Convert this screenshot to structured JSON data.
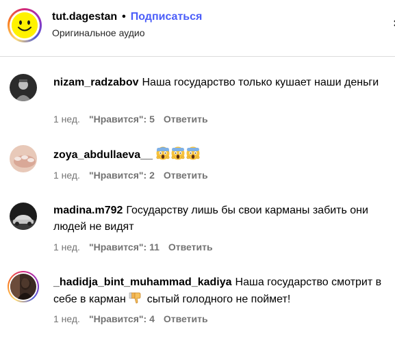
{
  "header": {
    "username": "tut.dagestan",
    "dot": "•",
    "follow_label": "Подписаться",
    "subtitle": "Оригинальное аудио",
    "avatar_icon": "smiley-face-icon",
    "follow_color": "#4a5df9"
  },
  "comments": [
    {
      "username": "nizam_radzabov",
      "text": "Наша государство только кушает наши деньги",
      "time": "1 нед.",
      "likes": "\"Нравится\": 5",
      "reply": "Ответить"
    },
    {
      "username": "zoya_abdullaeva__",
      "text": "",
      "emojis": [
        "scream-emoji",
        "scream-emoji",
        "scream-emoji"
      ],
      "time": "1 нед.",
      "likes": "\"Нравится\": 2",
      "reply": "Ответить"
    },
    {
      "username": "madina.m792",
      "text": "Государству лишь бы свои карманы забить они людей не видят",
      "time": "1 нед.",
      "likes": "\"Нравится\": 11",
      "reply": "Ответить"
    },
    {
      "username": "_hadidja_bint_muhammad_kadiya",
      "text_before": "Наша государство смотрит в себе в карман",
      "emoji": "thumbs-down-emoji",
      "text_after": "сытый голодного не поймет!",
      "time": "1 нед.",
      "likes": "\"Нравится\": 4",
      "reply": "Ответить"
    }
  ]
}
